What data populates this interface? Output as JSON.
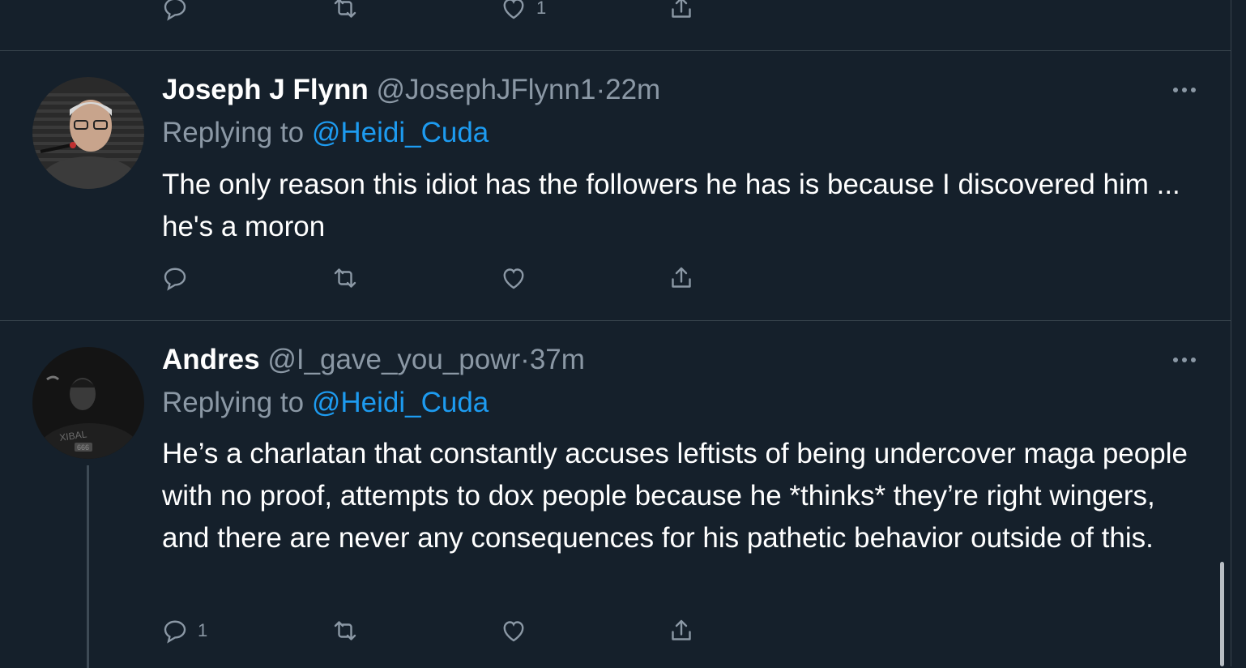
{
  "top_actions": {
    "like_count": "1"
  },
  "tweets": [
    {
      "name": "Joseph J Flynn",
      "handle": "@JosephJFlynn1",
      "separator": "·",
      "time": "22m",
      "replying_prefix": "Replying to",
      "replying_to": "@Heidi_Cuda",
      "text": "The only reason this idiot has the followers he has is because I discovered him ... he's a moron",
      "reply_count": ""
    },
    {
      "name": "Andres",
      "handle": "@I_gave_you_powr",
      "separator": "·",
      "time": "37m",
      "replying_prefix": "Replying to",
      "replying_to": "@Heidi_Cuda",
      "text": "He’s a charlatan that constantly accuses leftists of being undercover maga people with no proof, attempts to dox people because he *thinks* they’re right wingers, and there are never any consequences for his pathetic behavior outside of this.",
      "reply_count": "1",
      "avatar_shirt_text": "XIBAL",
      "avatar_badge_text": "666"
    }
  ],
  "colors": {
    "background": "#15202b",
    "border": "#38444d",
    "secondary_text": "#8b98a5",
    "link": "#1d9bf0"
  }
}
